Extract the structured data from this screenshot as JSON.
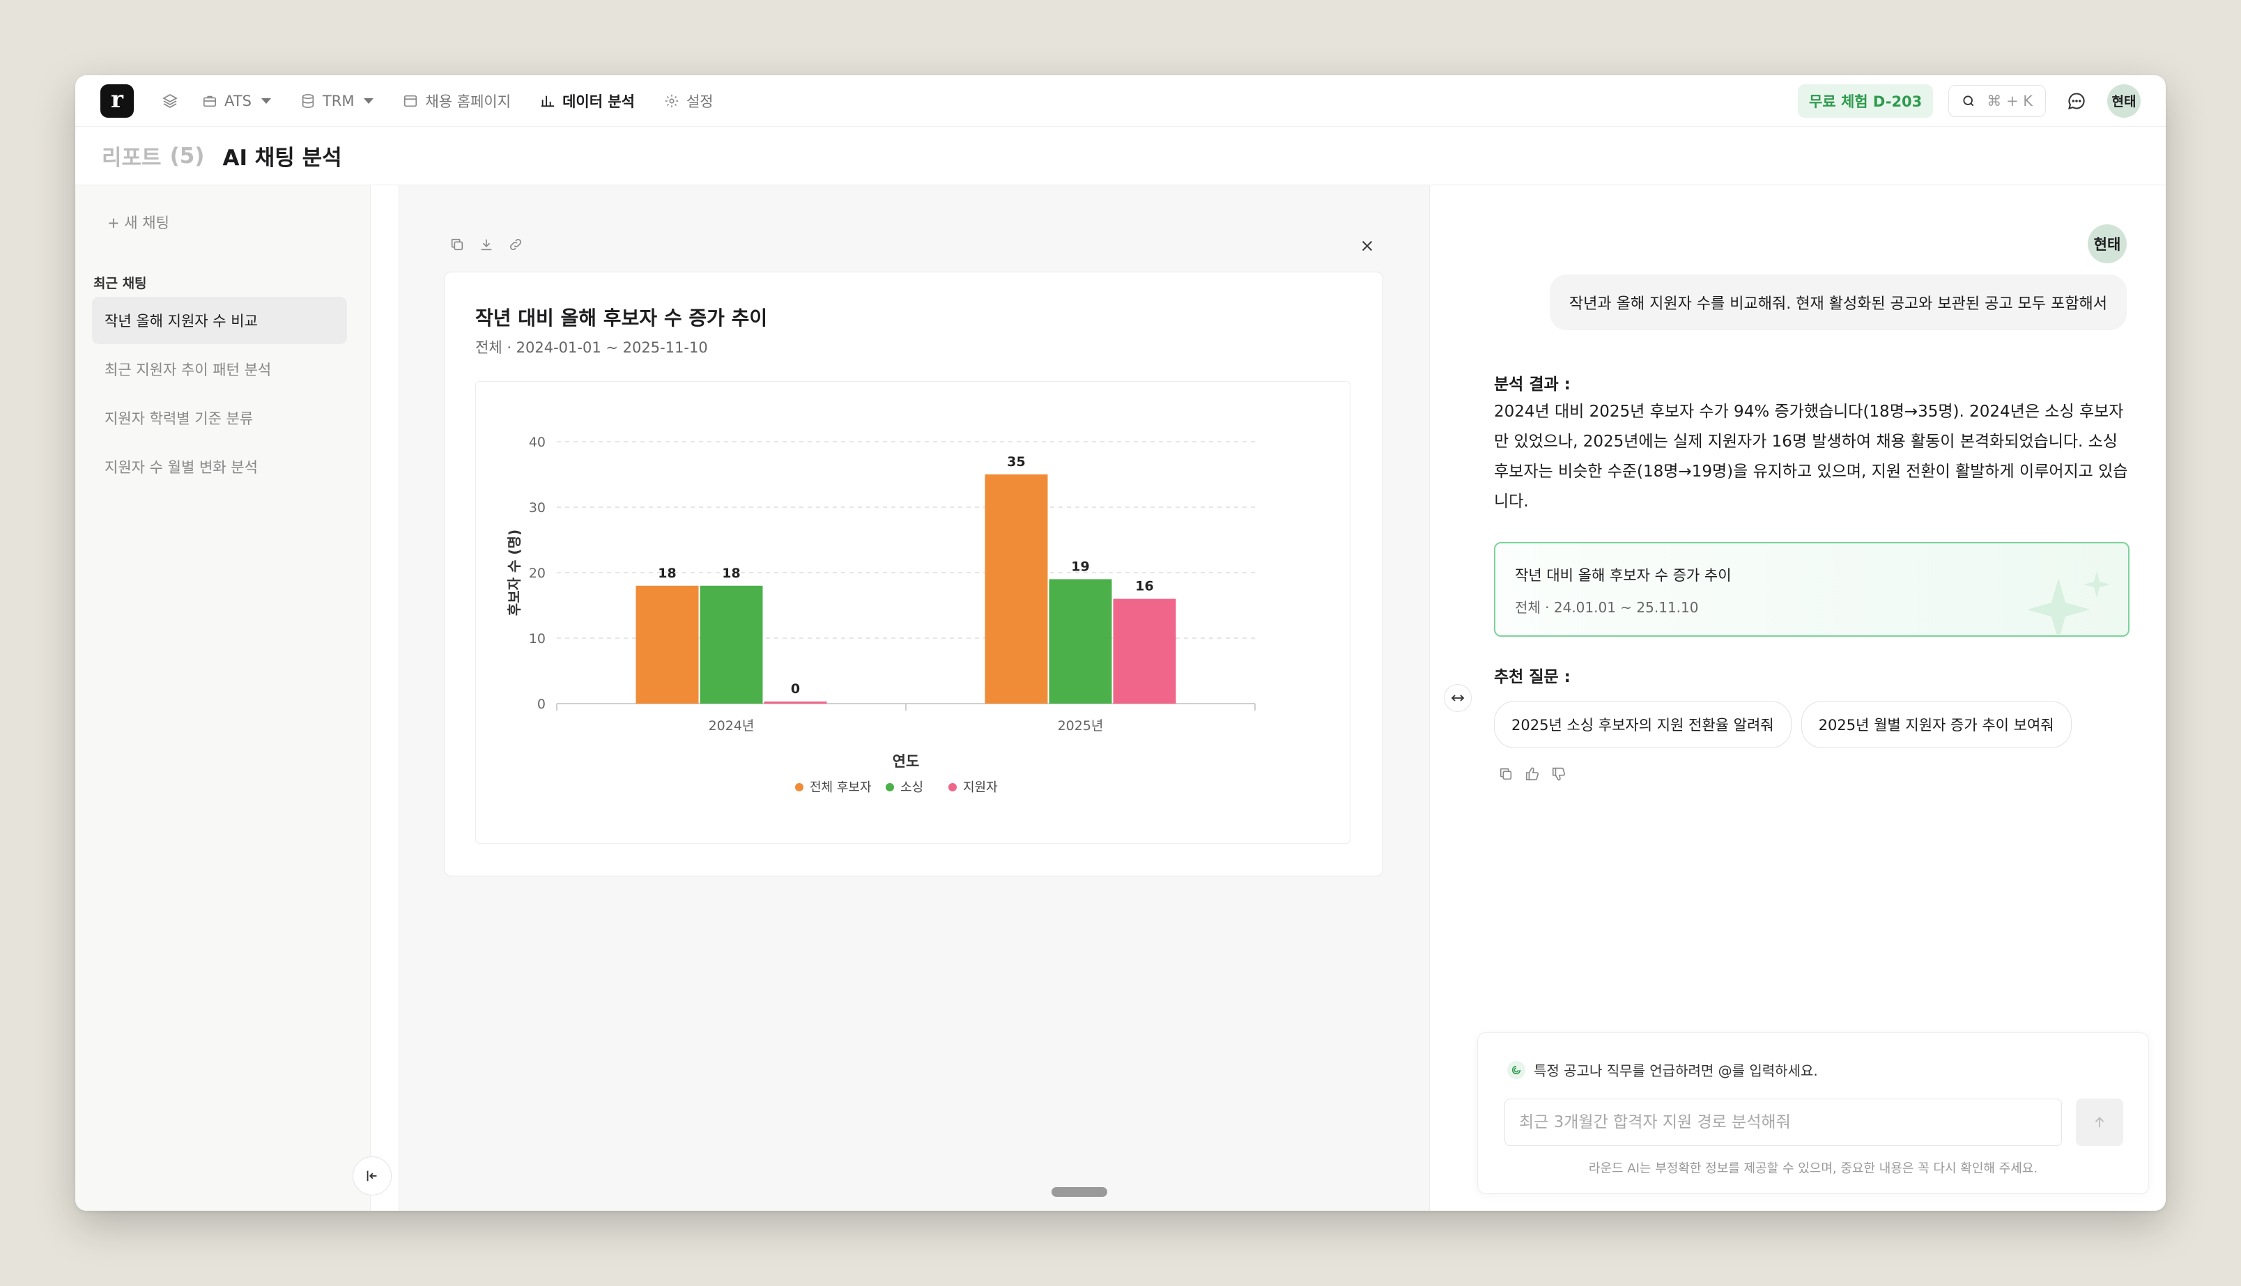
{
  "topbar": {
    "logo_letter": "r",
    "nav": [
      {
        "label": "ATS",
        "icon": "briefcase-icon"
      },
      {
        "label": "TRM",
        "icon": "database-icon"
      },
      {
        "label": "채용 홈페이지",
        "icon": "browser-icon"
      },
      {
        "label": "데이터 분석",
        "icon": "bar-chart-icon"
      },
      {
        "label": "설정",
        "icon": "gear-icon"
      }
    ],
    "trial_badge": "무료 체험 D-203",
    "search_shortcut": "⌘ + K",
    "user_avatar": "현태"
  },
  "subheader": {
    "breadcrumb": "리포트",
    "count": "(5)",
    "title": "AI 채팅 분석"
  },
  "sidebar": {
    "new_chat": "+ 새 채팅",
    "recent_label": "최근 채팅",
    "items": [
      {
        "label": "작년 올해 지원자 수 비교"
      },
      {
        "label": "최근 지원자 추이 패턴 분석"
      },
      {
        "label": "지원자 학력별 기준 분류"
      },
      {
        "label": "지원자 수 월별 변화 분석"
      }
    ]
  },
  "report": {
    "title": "작년 대비 올해 후보자 수 증가 추이",
    "subtitle": "전체 · 2024-01-01 ~ 2025-11-10"
  },
  "chart_data": {
    "type": "bar",
    "categories": [
      "2024년",
      "2025년"
    ],
    "series": [
      {
        "name": "전체 후보자",
        "values": [
          18,
          35
        ],
        "color": "#f08c38"
      },
      {
        "name": "소싱",
        "values": [
          18,
          19
        ],
        "color": "#4cb04a"
      },
      {
        "name": "지원자",
        "values": [
          0,
          16
        ],
        "color": "#f0668a"
      }
    ],
    "xlabel": "연도",
    "ylabel": "후보자 수 (명)",
    "ylim": [
      0,
      40
    ],
    "yticks": [
      0,
      10,
      20,
      30,
      40
    ],
    "grid": true,
    "legend": "bottom"
  },
  "chat": {
    "user_avatar": "현태",
    "user_message": "작년과 올해 지원자 수를 비교해줘. 현재 활성화된 공고와 보관된 공고 모두 포함해서",
    "result_label": "분석 결과 :",
    "result_text": "2024년 대비 2025년 후보자 수가 94% 증가했습니다(18명→35명). 2024년은 소싱 후보자만 있었으나, 2025년에는 실제 지원자가 16명 발생하여 채용 활동이 본격화되었습니다. 소싱 후보자는 비슷한 수준(18명→19명)을 유지하고 있으며, 지원 전환이 활발하게 이루어지고 있습니다.",
    "report_card": {
      "title": "작년 대비 올해 후보자 수 증가 추이",
      "subtitle": "전체 · 24.01.01 ~ 25.11.10"
    },
    "suggest_label": "추천 질문 :",
    "suggestions": [
      "2025년 소싱 후보자의 지원 전환율 알려줘",
      "2025년 월별 지원자 증가 추이 보여줘"
    ],
    "input_hint": "특정 공고나 직무를 언급하려면 @를 입력하세요.",
    "input_placeholder": "최근 3개월간 합격자 지원 경로 분석해줘",
    "disclaimer": "라운드 AI는 부정확한 정보를 제공할 수 있으며, 중요한 내용은 꼭 다시 확인해 주세요."
  }
}
